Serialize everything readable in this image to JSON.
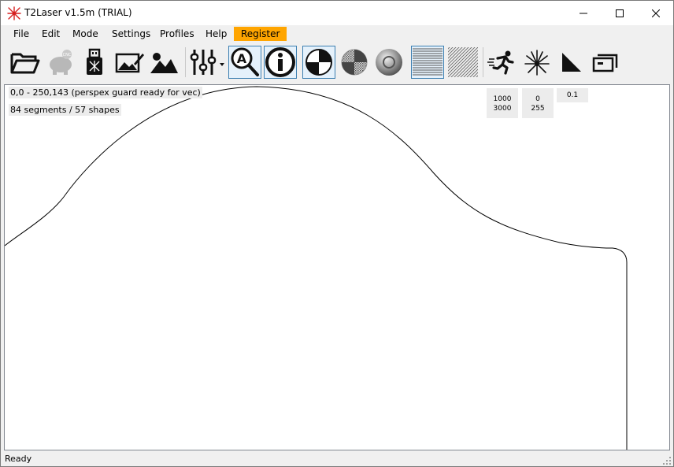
{
  "window": {
    "title": "T2Laser v1.5m (TRIAL)",
    "minimize_icon": "minimize-icon",
    "maximize_icon": "maximize-icon",
    "close_icon": "close-icon"
  },
  "menu": {
    "items": [
      "File",
      "Edit",
      "Mode",
      "Settings",
      "Profiles",
      "Help"
    ],
    "register_label": "Register",
    "register_color": "#ffa500"
  },
  "toolbar": {
    "buttons": [
      {
        "icon": "open-folder-icon"
      },
      {
        "icon": "piggy-bank-icon"
      },
      {
        "icon": "usb-laser-icon"
      },
      {
        "icon": "edit-image-icon"
      },
      {
        "icon": "image-landscape-icon"
      },
      {
        "icon": "sliders-icon"
      },
      {
        "icon": "zoom-text-icon",
        "selected": true
      },
      {
        "icon": "info-icon",
        "selected": true
      },
      {
        "icon": "checker-contrast-icon",
        "selected": true
      },
      {
        "icon": "dither-contrast-icon"
      },
      {
        "icon": "sphere-icon"
      },
      {
        "icon": "horizontal-lines-icon",
        "selected": true
      },
      {
        "icon": "diagonal-lines-icon"
      },
      {
        "icon": "running-man-icon"
      },
      {
        "icon": "laser-burst-icon"
      },
      {
        "icon": "ramp-icon"
      },
      {
        "icon": "frame-icon"
      }
    ]
  },
  "canvas": {
    "bounds_text": "0,0 - 250,143  (perspex guard ready for vec)",
    "segments_text": "84 segments / 57 shapes",
    "params": {
      "speed_top": "1000",
      "speed_bottom": "3000",
      "power_top": "0",
      "power_bottom": "255",
      "step": "0.1"
    }
  },
  "status": {
    "text": "Ready"
  }
}
